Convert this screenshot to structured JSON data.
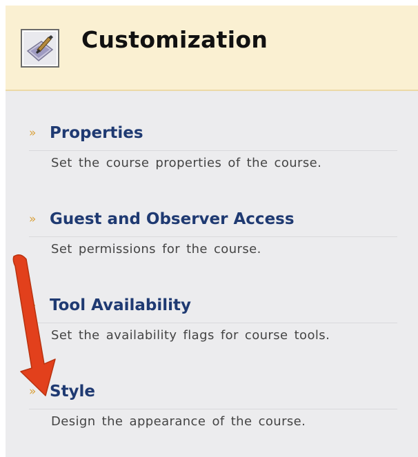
{
  "header": {
    "icon": "customization-palette-icon",
    "title": "Customization"
  },
  "items": [
    {
      "label": "Properties",
      "description": "Set the course properties of the course.",
      "has_bullet": true
    },
    {
      "label": "Guest and Observer Access",
      "description": "Set permissions for the course.",
      "has_bullet": true
    },
    {
      "label": "Tool Availability",
      "description": "Set the availability flags for course tools.",
      "has_bullet": true
    },
    {
      "label": "Style",
      "description": "Design the appearance of the course.",
      "has_bullet": true
    }
  ],
  "annotation": {
    "icon": "red-arrow-icon",
    "color": "#e2401c",
    "points_to": "Style"
  },
  "colors": {
    "header_bg": "#faf0d2",
    "panel_bg": "#ececee",
    "link": "#1f3a72",
    "bullet": "#d9a03a"
  }
}
